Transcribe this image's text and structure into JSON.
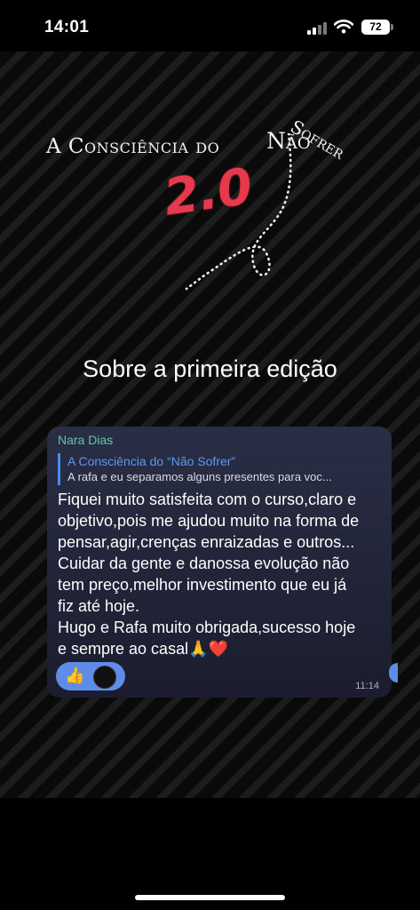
{
  "status": {
    "time": "14:01",
    "battery": "72"
  },
  "story": {
    "title_main": "A Consciência do",
    "title_nao": "Não",
    "title_sofrer": "Sofrer",
    "title_version": "2.0",
    "subtitle": "Sobre a primeira edição"
  },
  "message": {
    "sender": "Nara Dias",
    "quote_title": "A Consciência do “Não Sofrer”",
    "quote_text": "A rafa e eu separamos alguns presentes para voc...",
    "lines": [
      "Fiquei muito satisfeita com o curso,claro e",
      "objetivo,pois me ajudou muito na forma de",
      "pensar,agir,crenças enraizadas e outros...",
      "Cuidar da gente e danossa evolução não",
      "tem preço,melhor investimento que eu já",
      "fiz até hoje.",
      "Hugo e Rafa muito obrigada,sucesso hoje",
      "e sempre ao casal🙏❤️"
    ],
    "reaction_emoji": "👍",
    "time": "11:14"
  },
  "colors": {
    "accent_red": "#e6394b",
    "sender_green": "#5fc8a8",
    "quote_blue": "#5a98f4",
    "reaction_blue": "#5f8ce8"
  }
}
